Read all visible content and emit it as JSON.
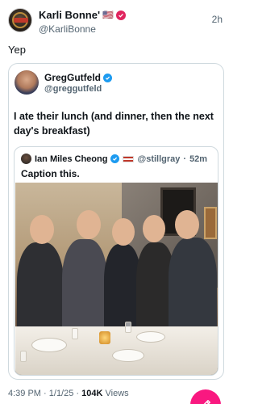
{
  "post": {
    "author_name": "Karli Bonne'",
    "flag": "🇺🇸",
    "handle": "@KarliBonne",
    "time": "2h",
    "text": "Yep"
  },
  "quote": {
    "author_name": "GregGutfeld",
    "handle": "@greggutfeld",
    "text": "I ate their lunch (and dinner, then the next day's breakfast)"
  },
  "inner_quote": {
    "author_name": "Ian Miles Cheong",
    "handle": "@stillgray",
    "time": "52m",
    "separator": "·",
    "text": "Caption this."
  },
  "meta": {
    "time": "4:39 PM",
    "date": "1/1/25",
    "views_count": "104K",
    "views_label": "Views",
    "separator": "·"
  },
  "colors": {
    "fab": "#f91880",
    "verified_blue": "#1d9bf0",
    "badge_red": "#e0245e",
    "muted_text": "#536471"
  },
  "icons": {
    "verified": "verified-badge-icon",
    "compose": "compose-feather-icon"
  }
}
